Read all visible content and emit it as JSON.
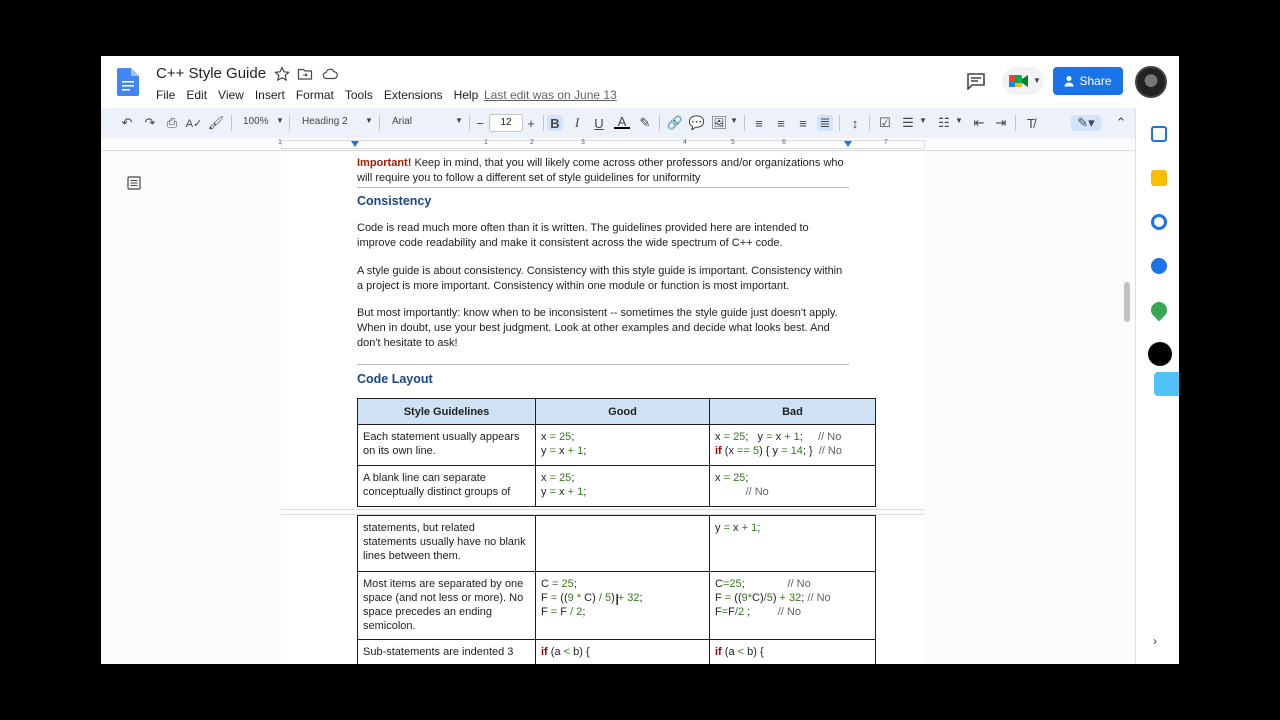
{
  "titlebar": {
    "doc_title": "C++ Style Guide",
    "menus": [
      "File",
      "Edit",
      "View",
      "Insert",
      "Format",
      "Tools",
      "Extensions",
      "Help"
    ],
    "last_edit": "Last edit was on June 13",
    "share_label": "Share"
  },
  "toolbar": {
    "zoom": "100%",
    "style": "Heading 2",
    "font": "Arial",
    "font_size": "12"
  },
  "ruler": {
    "numbers": [
      "1",
      "1",
      "2",
      "3",
      "4",
      "5",
      "6",
      "7"
    ]
  },
  "document": {
    "intro_important": "Important!",
    "intro_text": " Keep in mind, that you will likely come across other professors and/or organizations who will require you to follow a different set of style guidelines for uniformity",
    "consistency_heading": "Consistency",
    "para1": "Code is read much more often than it is written. The guidelines provided here are intended to improve code readability and make it consistent across the wide spectrum of C++ code.",
    "para2": "A style guide is about consistency. Consistency with this style guide is important. Consistency within a project is more important. Consistency within one module or function is most important.",
    "para3": "But most importantly: know when to be inconsistent -- sometimes the style guide just doesn't apply. When in doubt, use your best judgment. Look at other examples and decide what looks best. And don't hesitate to ask!",
    "layout_heading": "Code Layout",
    "table": {
      "headers": [
        "Style Guidelines",
        "Good",
        "Bad"
      ],
      "row1_guideline": "Each statement usually appears on its own line.",
      "row2_guideline_a": "A blank line can separate conceptually distinct groups of",
      "row2_guideline_b": "statements, but related statements usually have no blank lines between them.",
      "row3_guideline": "Most items are separated by one space (and not less or more). No space precedes an ending semicolon.",
      "row4_guideline": "Sub-statements are indented 3"
    }
  },
  "colors": {
    "brand_blue": "#1a73e8",
    "heading_blue": "#1c4587",
    "important_red": "#a61c00",
    "table_header_bg": "#cfe2f3"
  }
}
